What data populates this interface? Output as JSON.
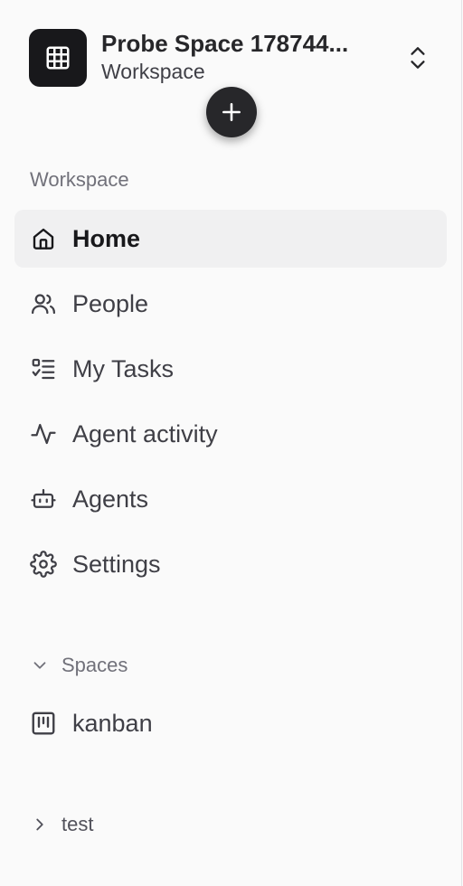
{
  "workspace": {
    "name": "Probe Space 178744...",
    "subtitle": "Workspace",
    "logo_icon": "grid-icon",
    "switch_icon": "chevron-up-down-icon"
  },
  "fab": {
    "icon": "plus-icon"
  },
  "nav": {
    "section_label": "Workspace",
    "items": [
      {
        "label": "Home",
        "icon": "home-icon",
        "active": true
      },
      {
        "label": "People",
        "icon": "users-icon",
        "active": false
      },
      {
        "label": "My Tasks",
        "icon": "task-list-icon",
        "active": false
      },
      {
        "label": "Agent activity",
        "icon": "activity-icon",
        "active": false
      },
      {
        "label": "Agents",
        "icon": "bot-icon",
        "active": false
      },
      {
        "label": "Settings",
        "icon": "gear-icon",
        "active": false
      }
    ]
  },
  "spaces": {
    "label": "Spaces",
    "expanded": true,
    "items": [
      {
        "label": "kanban",
        "icon": "kanban-icon"
      }
    ]
  },
  "groups": [
    {
      "label": "test",
      "expanded": false
    }
  ],
  "colors": {
    "background": "#fafafa",
    "active_bg": "#f0f0f1",
    "logo_bg": "#18181b",
    "text": "#27272a",
    "muted": "#71717a"
  }
}
